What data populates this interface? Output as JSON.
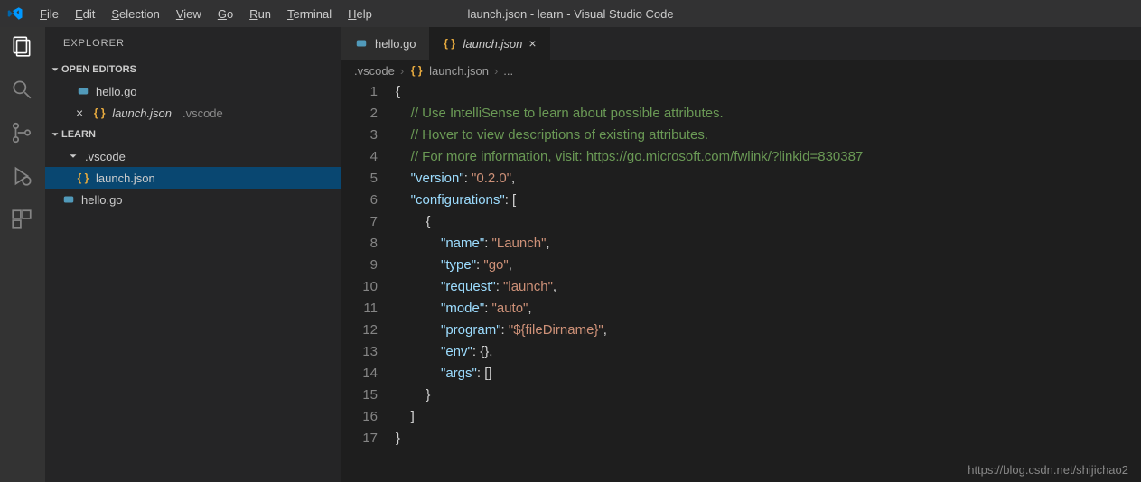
{
  "window": {
    "title": "launch.json - learn - Visual Studio Code"
  },
  "menu": {
    "file": "File",
    "edit": "Edit",
    "selection": "Selection",
    "view": "View",
    "go": "Go",
    "run": "Run",
    "terminal": "Terminal",
    "help": "Help"
  },
  "sidebar": {
    "panel_title": "EXPLORER",
    "open_editors": {
      "title": "OPEN EDITORS",
      "items": [
        {
          "icon": "go",
          "label": "hello.go",
          "dirty": false,
          "close": false
        },
        {
          "icon": "json",
          "label": "launch.json",
          "suffix": ".vscode",
          "dirty": false,
          "close": true,
          "italic": true
        }
      ]
    },
    "project": {
      "title": "LEARN",
      "items": [
        {
          "type": "folder",
          "label": ".vscode",
          "depth": 1
        },
        {
          "type": "file",
          "icon": "json",
          "label": "launch.json",
          "depth": 2,
          "active": true
        },
        {
          "type": "file",
          "icon": "go",
          "label": "hello.go",
          "depth": 0
        }
      ]
    }
  },
  "tabs": [
    {
      "icon": "go",
      "label": "hello.go",
      "active": false,
      "close": false
    },
    {
      "icon": "json",
      "label": "launch.json",
      "active": true,
      "close": true,
      "italic": true
    }
  ],
  "breadcrumbs": {
    "folder": ".vscode",
    "file": "launch.json",
    "more": "..."
  },
  "code": {
    "comments": [
      "// Use IntelliSense to learn about possible attributes.",
      "// Hover to view descriptions of existing attributes.",
      "// For more information, visit: "
    ],
    "link": "https://go.microsoft.com/fwlink/?linkid=830387",
    "version_key": "\"version\"",
    "version_val": "\"0.2.0\"",
    "configs_key": "\"configurations\"",
    "name_key": "\"name\"",
    "name_val": "\"Launch\"",
    "type_key": "\"type\"",
    "type_val": "\"go\"",
    "request_key": "\"request\"",
    "request_val": "\"launch\"",
    "mode_key": "\"mode\"",
    "mode_val": "\"auto\"",
    "program_key": "\"program\"",
    "program_val": "\"${fileDirname}\"",
    "env_key": "\"env\"",
    "env_val": "{}",
    "args_key": "\"args\"",
    "args_val": "[]"
  },
  "gutter": [
    "1",
    "2",
    "3",
    "4",
    "5",
    "6",
    "7",
    "8",
    "9",
    "10",
    "11",
    "12",
    "13",
    "14",
    "15",
    "16",
    "17"
  ],
  "watermark": "https://blog.csdn.net/shijichao2"
}
